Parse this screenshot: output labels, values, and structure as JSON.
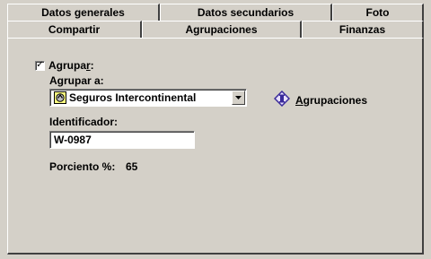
{
  "tabs_top": [
    {
      "label": "Datos generales"
    },
    {
      "label": "Datos secundarios"
    },
    {
      "label": "Foto"
    }
  ],
  "tabs_bottom": [
    {
      "label": "Compartir"
    },
    {
      "label": "Agrupaciones"
    },
    {
      "label": "Finanzas"
    }
  ],
  "group": {
    "checkbox_checked": true,
    "checkbox_mark": "✓",
    "checkbox_label_prefix": "Agrupa",
    "checkbox_label_accel": "r",
    "checkbox_label_suffix": ":",
    "agrupar_a_label": "Agrupar a:",
    "combo_value": "Seguros Intercontinental",
    "combo_icon": "insurance-icon",
    "groups_button_label_accel": "A",
    "groups_button_label_rest": "grupaciones",
    "groups_button_icon": "groups-diamond-icon",
    "identifier_label": "Identificador:",
    "identifier_value": "W-0987",
    "percent_label": "Porciento %:",
    "percent_value": "65"
  }
}
